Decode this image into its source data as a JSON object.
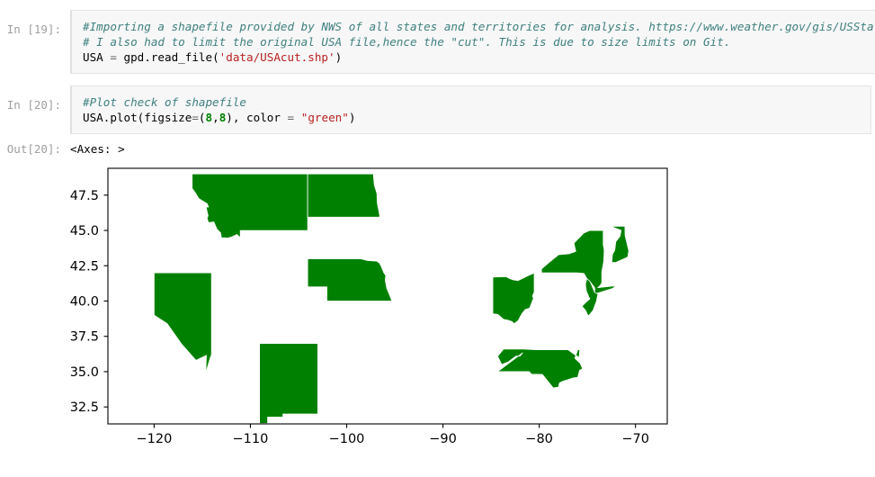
{
  "notebook": {
    "cells": [
      {
        "kind": "input",
        "prompt": "In [19]:",
        "lines": [
          [
            {
              "t": "cmt",
              "s": "#Importing a shapefile provided by NWS of all states and territories for analysis. https://www.weather.gov/gis/USStates"
            }
          ],
          [
            {
              "t": "cmt",
              "s": "# I also had to limit the original USA file,hence the \"cut\". This is due to size limits on Git."
            }
          ],
          [
            {
              "t": "kw",
              "s": "USA "
            },
            {
              "t": "op",
              "s": "="
            },
            {
              "t": "kw",
              "s": " gpd.read_file("
            },
            {
              "t": "str",
              "s": "'data/USAcut.shp'"
            },
            {
              "t": "kw",
              "s": ")"
            }
          ]
        ]
      },
      {
        "kind": "input",
        "prompt": "In [20]:",
        "lines": [
          [
            {
              "t": "cmt",
              "s": "#Plot check of shapefile"
            }
          ],
          [
            {
              "t": "kw",
              "s": "USA.plot(figsize"
            },
            {
              "t": "op",
              "s": "="
            },
            {
              "t": "kw",
              "s": "("
            },
            {
              "t": "num",
              "s": "8"
            },
            {
              "t": "kw",
              "s": ","
            },
            {
              "t": "num",
              "s": "8"
            },
            {
              "t": "kw",
              "s": "), color "
            },
            {
              "t": "op",
              "s": "="
            },
            {
              "t": "kw",
              "s": " "
            },
            {
              "t": "str",
              "s": "\"green\""
            },
            {
              "t": "kw",
              "s": ")"
            }
          ]
        ]
      },
      {
        "kind": "output",
        "prompt": "Out[20]:",
        "text": "<Axes: >"
      }
    ]
  },
  "chart_data": {
    "type": "map",
    "title": "",
    "xlabel": "",
    "ylabel": "",
    "face_color": "#ffffff",
    "geometry_color": "#008000",
    "edge_color": "#ffffff",
    "spine_color": "#000000",
    "grid": false,
    "legend": null,
    "xlim": [
      -124.8,
      -66.7
    ],
    "ylim": [
      31.3,
      49.4
    ],
    "xticks": [
      -120,
      -110,
      -100,
      -90,
      -80,
      -70
    ],
    "xticklabels": [
      "−120",
      "−110",
      "−100",
      "−90",
      "−80",
      "−70"
    ],
    "yticks": [
      32.5,
      35.0,
      37.5,
      40.0,
      42.5,
      45.0,
      47.5
    ],
    "yticklabels": [
      "32.5",
      "35.0",
      "37.5",
      "40.0",
      "42.5",
      "45.0",
      "47.5"
    ],
    "features": [
      {
        "name": "Montana",
        "centroid": [
          -109.6,
          47.0
        ]
      },
      {
        "name": "North Dakota",
        "centroid": [
          -100.5,
          47.4
        ]
      },
      {
        "name": "Nevada",
        "centroid": [
          -116.7,
          39.3
        ]
      },
      {
        "name": "Nebraska",
        "centroid": [
          -99.7,
          41.5
        ]
      },
      {
        "name": "New Mexico",
        "centroid": [
          -106.1,
          34.4
        ]
      },
      {
        "name": "Ohio",
        "centroid": [
          -82.8,
          40.3
        ]
      },
      {
        "name": "New York",
        "centroid": [
          -75.5,
          42.9
        ]
      },
      {
        "name": "New Hampshire",
        "centroid": [
          -71.6,
          43.7
        ]
      },
      {
        "name": "New Jersey",
        "centroid": [
          -74.7,
          40.1
        ]
      },
      {
        "name": "North Carolina",
        "centroid": [
          -79.4,
          35.5
        ]
      }
    ]
  }
}
